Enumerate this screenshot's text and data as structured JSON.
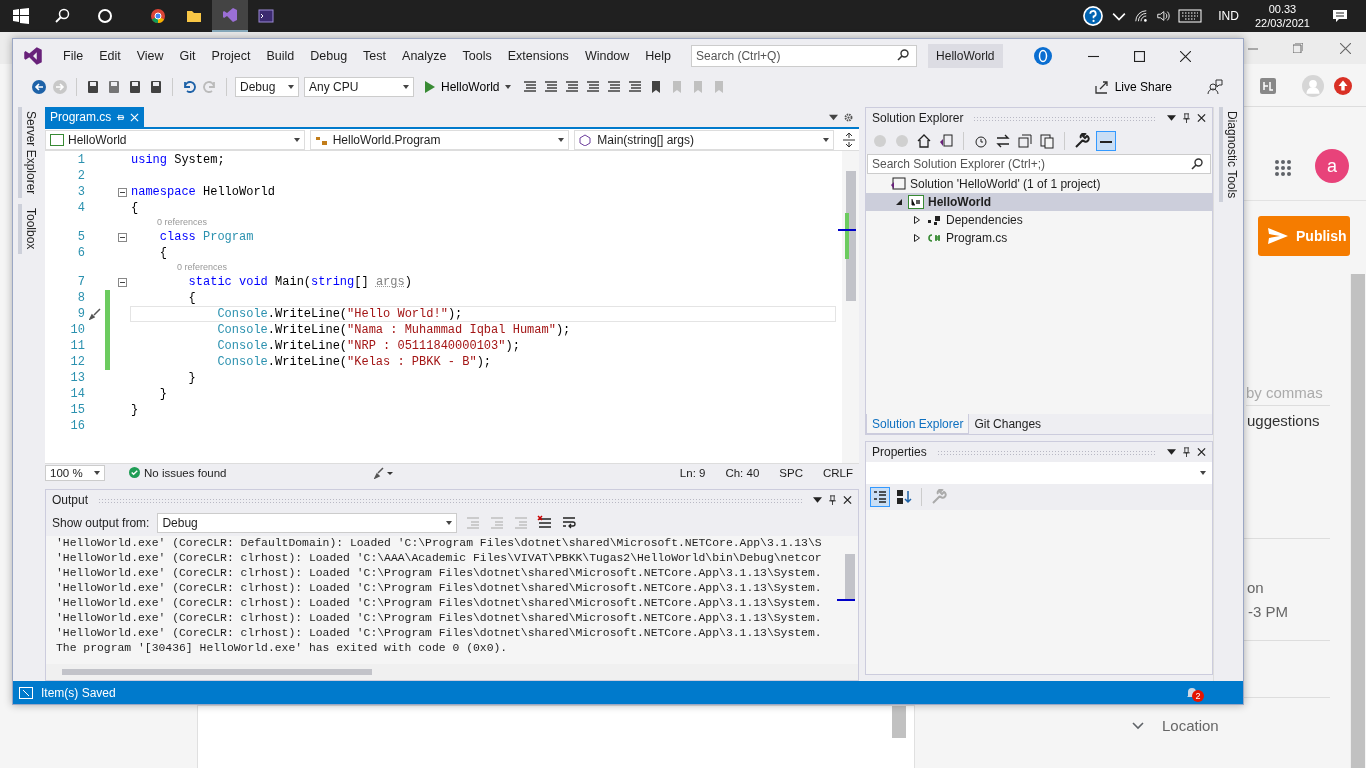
{
  "taskbar": {
    "language": "IND",
    "time": "00.33",
    "date": "22/03/2021"
  },
  "browser": {
    "publish": "Publish",
    "avatar": "a",
    "tags_hint": "by commas",
    "suggestions": "uggestions",
    "field_1": "on",
    "field_2": "-3 PM",
    "location": "Location"
  },
  "vs": {
    "menu": [
      "File",
      "Edit",
      "View",
      "Git",
      "Project",
      "Build",
      "Debug",
      "Test",
      "Analyze",
      "Tools",
      "Extensions",
      "Window",
      "Help"
    ],
    "search": {
      "placeholder": "Search (Ctrl+Q)"
    },
    "solution_badge": "HelloWorld",
    "toolbar": {
      "configuration": "Debug",
      "platform": "Any CPU",
      "start": "HelloWorld",
      "live_share": "Live Share"
    },
    "left_tabs": [
      "Server Explorer",
      "Toolbox"
    ],
    "right_tabs": [
      "Diagnostic Tools"
    ],
    "editor": {
      "tabs": [
        {
          "label": "Program.cs",
          "selected": true
        }
      ],
      "nav": [
        "HelloWorld",
        "HelloWorld.Program",
        "Main(string[] args)"
      ],
      "lines": [
        {
          "kind": "code",
          "number": "1",
          "fold": false,
          "changed": false,
          "current": false,
          "tokens": [
            {
              "kind": "kw",
              "text": "using"
            },
            {
              "kind": "plain",
              "text": " System;"
            }
          ]
        },
        {
          "kind": "code",
          "number": "2",
          "fold": false,
          "changed": false,
          "current": false
        },
        {
          "kind": "code",
          "number": "3",
          "fold": true,
          "changed": false,
          "current": false,
          "tokens": [
            {
              "kind": "kw",
              "text": "namespace"
            },
            {
              "kind": "plain",
              "text": " HelloWorld"
            }
          ]
        },
        {
          "kind": "code",
          "number": "4",
          "fold": false,
          "changed": false,
          "current": false,
          "tokens": [
            {
              "kind": "plain",
              "text": "{"
            }
          ]
        },
        {
          "kind": "lens",
          "text": "0 references"
        },
        {
          "kind": "code",
          "number": "5",
          "fold": true,
          "changed": false,
          "current": false,
          "tokens": [
            {
              "kind": "kw",
              "text": "    class"
            },
            {
              "kind": "type",
              "text": " Program"
            }
          ]
        },
        {
          "kind": "code",
          "number": "6",
          "fold": false,
          "changed": false,
          "current": false,
          "tokens": [
            {
              "kind": "plain",
              "text": "    {"
            }
          ]
        },
        {
          "kind": "lens",
          "text": "0 references"
        },
        {
          "kind": "code",
          "number": "7",
          "fold": true,
          "changed": false,
          "current": false,
          "tokens": [
            {
              "kind": "kw",
              "text": "        static void"
            },
            {
              "kind": "plain",
              "text": " Main("
            },
            {
              "kind": "kw",
              "text": "string"
            },
            {
              "kind": "plain",
              "text": "[] "
            },
            {
              "kind": "param",
              "text": "args"
            },
            {
              "kind": "plain",
              "text": ")"
            }
          ]
        },
        {
          "kind": "code",
          "number": "8",
          "fold": false,
          "changed": true,
          "current": false,
          "tokens": [
            {
              "kind": "plain",
              "text": "        {"
            }
          ]
        },
        {
          "kind": "code",
          "number": "9",
          "fold": false,
          "changed": true,
          "current": true,
          "tokens": [
            {
              "kind": "type",
              "text": "            Console"
            },
            {
              "kind": "plain",
              "text": ".WriteLine("
            },
            {
              "kind": "str",
              "text": "\"Hello World!\""
            },
            {
              "kind": "plain",
              "text": ");"
            }
          ]
        },
        {
          "kind": "code",
          "number": "10",
          "fold": false,
          "changed": true,
          "current": false,
          "tokens": [
            {
              "kind": "type",
              "text": "            Console"
            },
            {
              "kind": "plain",
              "text": ".WriteLine("
            },
            {
              "kind": "str",
              "text": "\"Nama : Muhammad Iqbal Humam\""
            },
            {
              "kind": "plain",
              "text": ");"
            }
          ]
        },
        {
          "kind": "code",
          "number": "11",
          "fold": false,
          "changed": true,
          "current": false,
          "tokens": [
            {
              "kind": "type",
              "text": "            Console"
            },
            {
              "kind": "plain",
              "text": ".WriteLine("
            },
            {
              "kind": "str",
              "text": "\"NRP : 05111840000103\""
            },
            {
              "kind": "plain",
              "text": ");"
            }
          ]
        },
        {
          "kind": "code",
          "number": "12",
          "fold": false,
          "changed": true,
          "current": false,
          "tokens": [
            {
              "kind": "type",
              "text": "            Console"
            },
            {
              "kind": "plain",
              "text": ".WriteLine("
            },
            {
              "kind": "str",
              "text": "\"Kelas : PBKK - B\""
            },
            {
              "kind": "plain",
              "text": ");"
            }
          ]
        },
        {
          "kind": "code",
          "number": "13",
          "fold": false,
          "changed": false,
          "current": false,
          "tokens": [
            {
              "kind": "plain",
              "text": "        }"
            }
          ]
        },
        {
          "kind": "code",
          "number": "14",
          "fold": false,
          "changed": false,
          "current": false,
          "tokens": [
            {
              "kind": "plain",
              "text": "    }"
            }
          ]
        },
        {
          "kind": "code",
          "number": "15",
          "fold": false,
          "changed": false,
          "current": false,
          "tokens": [
            {
              "kind": "plain",
              "text": "}"
            }
          ]
        },
        {
          "kind": "code",
          "number": "16",
          "fold": false,
          "changed": false,
          "current": false
        }
      ],
      "zoom": "100 %",
      "issues": "No issues found",
      "position": [
        "Ln: 9",
        "Ch: 40",
        "SPC",
        "CRLF"
      ]
    },
    "output": {
      "title": "Output",
      "source_label": "Show output from:",
      "source": "Debug",
      "lines": [
        "'HelloWorld.exe' (CoreCLR: DefaultDomain): Loaded 'C:\\Program Files\\dotnet\\shared\\Microsoft.NETCore.App\\3.1.13\\S",
        "'HelloWorld.exe' (CoreCLR: clrhost): Loaded 'C:\\AAA\\Academic Files\\VIVAT\\PBKK\\Tugas2\\HelloWorld\\bin\\Debug\\netcor",
        "'HelloWorld.exe' (CoreCLR: clrhost): Loaded 'C:\\Program Files\\dotnet\\shared\\Microsoft.NETCore.App\\3.1.13\\System.",
        "'HelloWorld.exe' (CoreCLR: clrhost): Loaded 'C:\\Program Files\\dotnet\\shared\\Microsoft.NETCore.App\\3.1.13\\System.",
        "'HelloWorld.exe' (CoreCLR: clrhost): Loaded 'C:\\Program Files\\dotnet\\shared\\Microsoft.NETCore.App\\3.1.13\\System.",
        "'HelloWorld.exe' (CoreCLR: clrhost): Loaded 'C:\\Program Files\\dotnet\\shared\\Microsoft.NETCore.App\\3.1.13\\System.",
        "'HelloWorld.exe' (CoreCLR: clrhost): Loaded 'C:\\Program Files\\dotnet\\shared\\Microsoft.NETCore.App\\3.1.13\\System.",
        "The program '[30436] HelloWorld.exe' has exited with code 0 (0x0)."
      ]
    },
    "solution_explorer": {
      "title": "Solution Explorer",
      "search": {
        "placeholder": "Search Solution Explorer (Ctrl+;)"
      },
      "tree": [
        {
          "label": "Solution 'HelloWorld' (1 of 1 project)",
          "kind": "solution",
          "selected": false,
          "children": [
            {
              "label": "HelloWorld",
              "kind": "project",
              "selected": true,
              "expanded": true,
              "children": [
                {
                  "label": "Dependencies",
                  "kind": "dependencies",
                  "selected": false,
                  "expanded": false
                },
                {
                  "label": "Program.cs",
                  "kind": "csfile",
                  "selected": false,
                  "expanded": false
                }
              ]
            }
          ]
        }
      ],
      "tabs": [
        {
          "label": "Solution Explorer",
          "selected": true
        },
        {
          "label": "Git Changes",
          "selected": false
        }
      ]
    },
    "properties": {
      "title": "Properties"
    },
    "status": {
      "message": "Item(s) Saved",
      "notifications": "2"
    }
  }
}
